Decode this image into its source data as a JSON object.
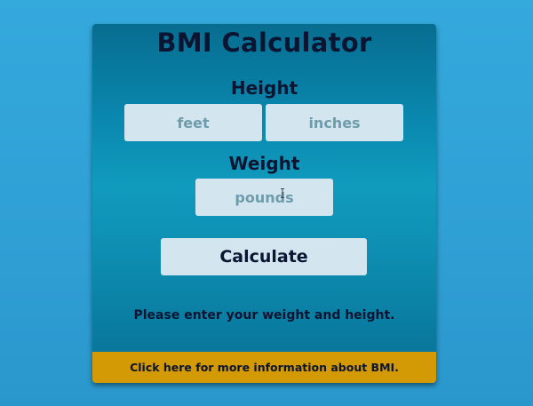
{
  "app": {
    "title": "BMI Calculator"
  },
  "height_section": {
    "label": "Height",
    "feet_placeholder": "feet",
    "inches_placeholder": "inches",
    "feet_value": "",
    "inches_value": ""
  },
  "weight_section": {
    "label": "Weight",
    "pounds_placeholder": "pounds",
    "pounds_value": ""
  },
  "actions": {
    "calculate_label": "Calculate"
  },
  "status": {
    "message": "Please enter your weight and height."
  },
  "footer": {
    "info_link": "Click here for more information about BMI."
  },
  "colors": {
    "background": "#2ea6d8",
    "card": "#0a86ad",
    "field_bg": "#d3e6ef",
    "text_dark": "#0b1430",
    "accent_bar": "#d49a06"
  },
  "icons": {
    "cursor": "text-cursor-icon"
  }
}
